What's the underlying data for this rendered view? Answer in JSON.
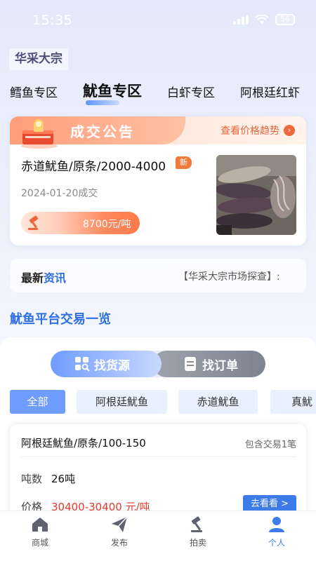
{
  "status": {
    "time": "15:35",
    "battery": "56"
  },
  "brand": "华采大宗",
  "tabs": [
    {
      "label": "鳕鱼专区",
      "active": false
    },
    {
      "label": "魷鱼专区",
      "active": true
    },
    {
      "label": "白虾专区",
      "active": false
    },
    {
      "label": "阿根廷红虾",
      "active": false
    }
  ],
  "notice": {
    "title": "成交公告",
    "trend_link": "查看价格趋势",
    "product": "赤道魷鱼/原条/2000-4000",
    "badge": "新",
    "date": "2024-01-20成交",
    "price": "8700元/吨"
  },
  "news": {
    "label_prefix": "最新",
    "label_highlight": "资讯",
    "marquee": "【华采大宗市场探查】:"
  },
  "section_title": "魷鱼平台交易一览",
  "segment": {
    "left_label": "找货源",
    "right_label": "找订单",
    "active": "left"
  },
  "filters": [
    "全部",
    "阿根廷魷鱼",
    "赤道魷鱼",
    "真魷"
  ],
  "listing": {
    "title": "阿根廷魷鱼/原条/100-150",
    "count": "包含交易1笔",
    "tonnage_label": "吨数",
    "tonnage_value": "26吨",
    "price_label": "价格",
    "price_value": "30400-30400 元/吨",
    "view_button": "去看看 >"
  },
  "nav": [
    {
      "label": "商城",
      "icon": "home-icon",
      "active": false
    },
    {
      "label": "发布",
      "icon": "send-icon",
      "active": false
    },
    {
      "label": "拍卖",
      "icon": "gavel-icon",
      "active": false
    },
    {
      "label": "个人",
      "icon": "user-icon",
      "active": true
    }
  ],
  "colors": {
    "accent_blue": "#3d7be8",
    "notice_orange": "#ee6a3c",
    "price_red": "#e03a2c"
  }
}
